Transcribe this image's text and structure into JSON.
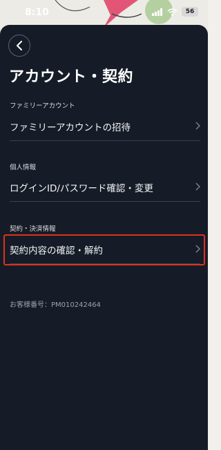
{
  "status_bar": {
    "time": "8:10",
    "battery": "56"
  },
  "header": {
    "title": "アカウント・契約"
  },
  "sections": [
    {
      "header": "ファミリーアカウント",
      "items": [
        {
          "label": "ファミリーアカウントの招待"
        }
      ]
    },
    {
      "header": "個人情報",
      "items": [
        {
          "label": "ログインID/パスワード確認・変更"
        }
      ]
    },
    {
      "header": "契約・決済情報",
      "items": [
        {
          "label": "契約内容の確認・解約",
          "highlighted": true
        }
      ]
    }
  ],
  "customer_number": "お客様番号：PM010242464",
  "colors": {
    "sheet_background": "#161c27",
    "highlight_border": "#e0311f"
  },
  "icons": {
    "back": "chevron-left-icon",
    "row_arrow": "chevron-right-icon"
  }
}
